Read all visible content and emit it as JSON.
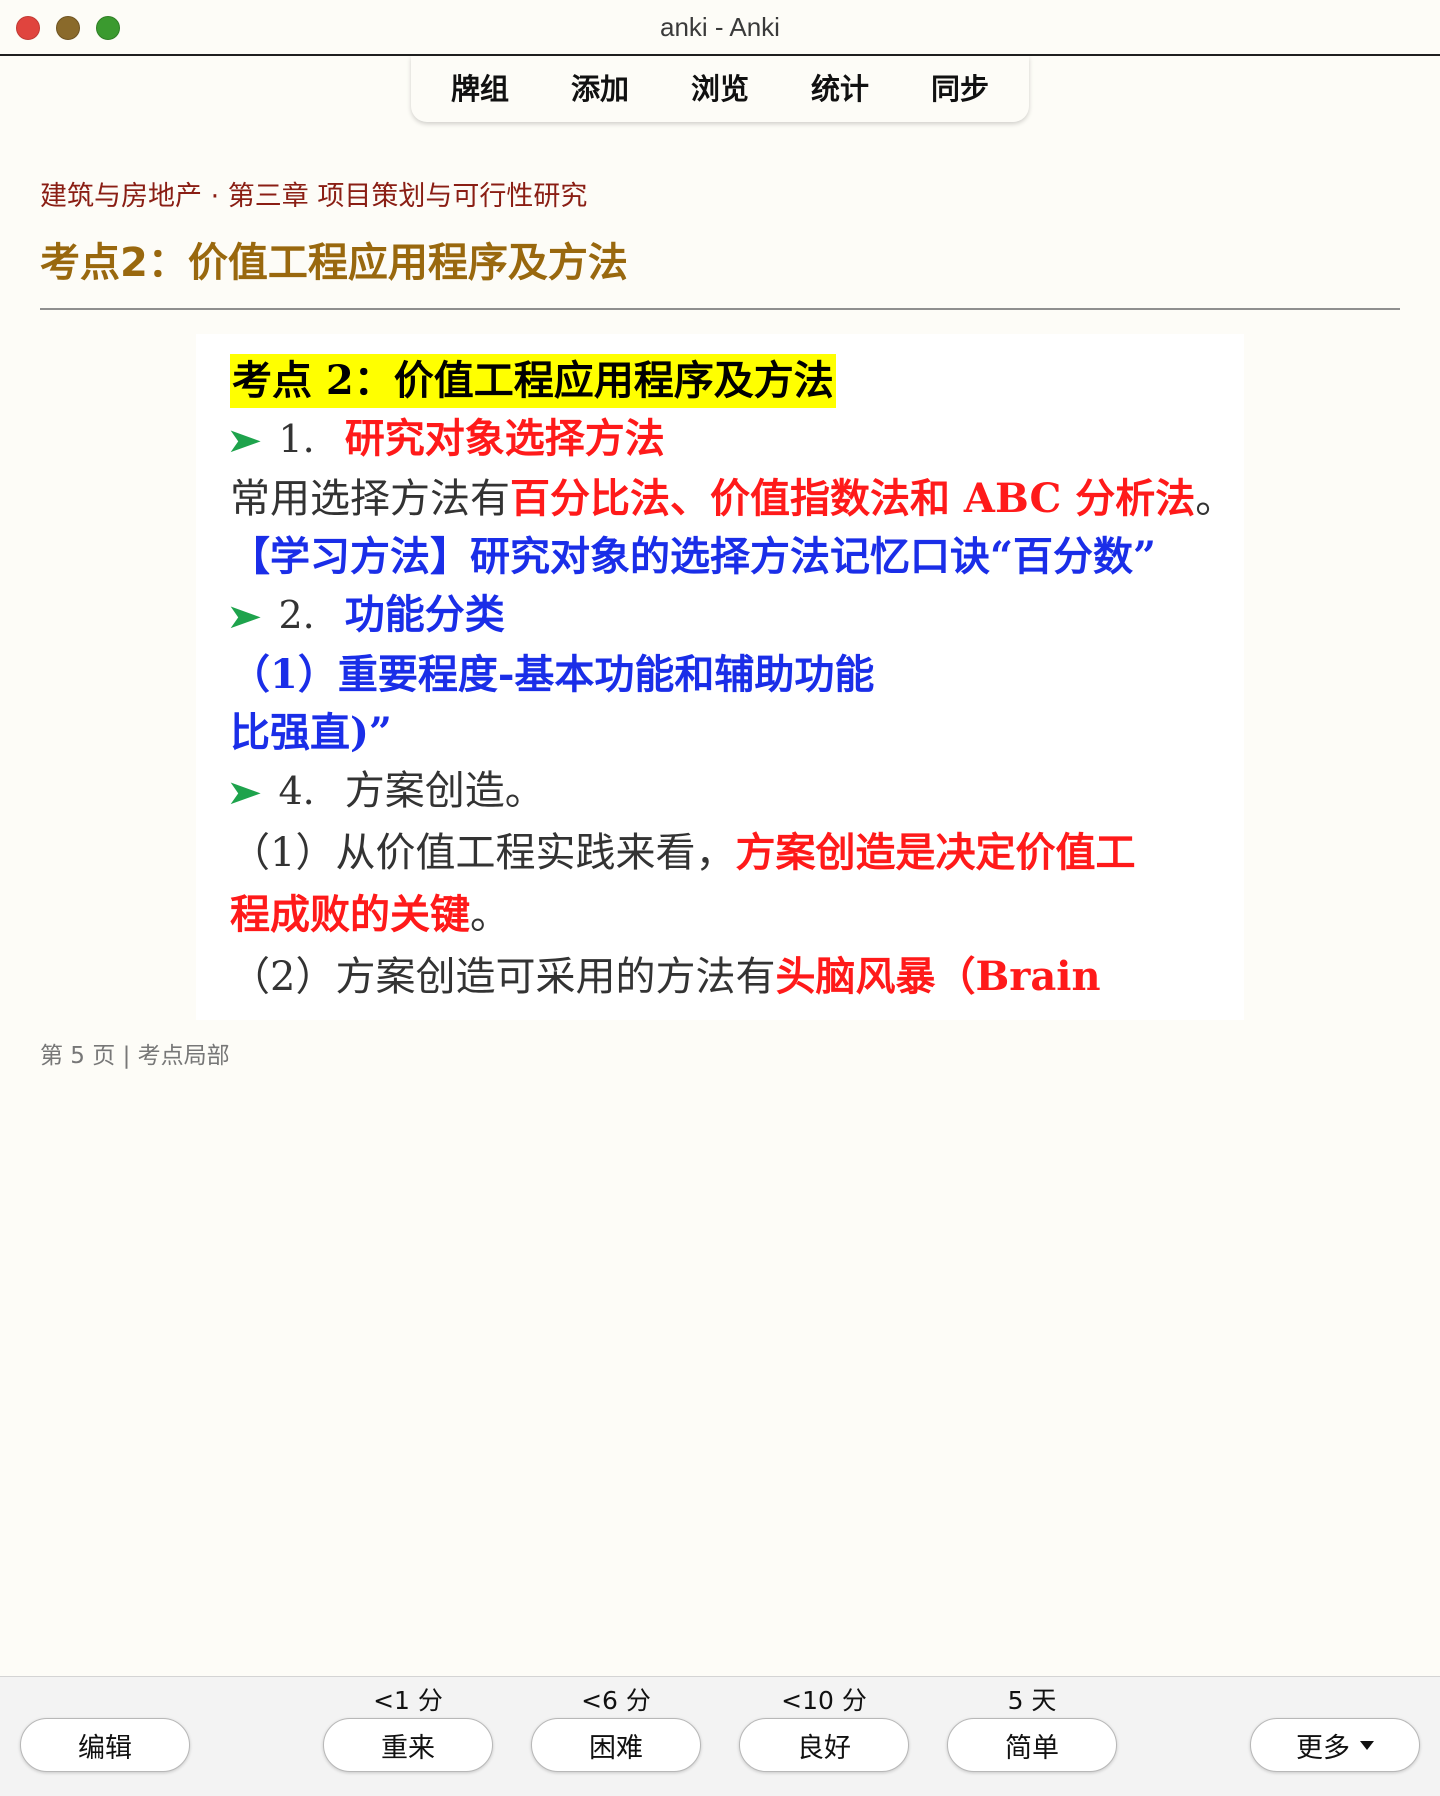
{
  "window": {
    "title": "anki - Anki"
  },
  "nav": {
    "items": [
      "牌组",
      "添加",
      "浏览",
      "统计",
      "同步"
    ]
  },
  "card": {
    "breadcrumb": "建筑与房地产 · 第三章 项目策划与可行性研究",
    "title": "考点2：价值工程应用程序及方法",
    "image_text": {
      "heading": "考点 2：价值工程应用程序及方法",
      "item1_num": "1.",
      "item1_label": "研究对象选择方法",
      "line_methods_plain": "常用选择方法有",
      "line_methods_red": "百分比法、价值指数法和 ABC 分析法",
      "line_methods_end": "。",
      "line_study": "【学习方法】研究对象的选择方法记忆口诀“百分数”",
      "item2_num": "2.",
      "item2_label": "功能分类",
      "line_func": "（1）重要程度-基本功能和辅助功能",
      "line_partial": "比强直)”",
      "item4_num": "4.",
      "item4_label": "方案创造。",
      "line_p1_plain": "（1）从价值工程实践来看，",
      "line_p1_red": "方案创造是决定价值工",
      "line_p1b_red": "程成败的关键",
      "line_p1b_end": "。",
      "line_p2_plain": "（2）方案创造可采用的方法有",
      "line_p2_red": "头脑风暴（Brain"
    },
    "footer": "第 5 页 | 考点局部"
  },
  "answer_bar": {
    "edit_label": "编辑",
    "more_label": "更多",
    "buttons": [
      {
        "label": "重来",
        "interval": "<1 分"
      },
      {
        "label": "困难",
        "interval": "<6 分"
      },
      {
        "label": "良好",
        "interval": "<10 分"
      },
      {
        "label": "简单",
        "interval": "5 天"
      }
    ]
  },
  "colors": {
    "background": "#fdfcf7",
    "breadcrumb": "#8a1e14",
    "title": "#99680e",
    "highlight": "#ffff00",
    "red_text": "#ff1a1a",
    "blue_text": "#1a2ee8",
    "arrow": "#1ea34c"
  }
}
